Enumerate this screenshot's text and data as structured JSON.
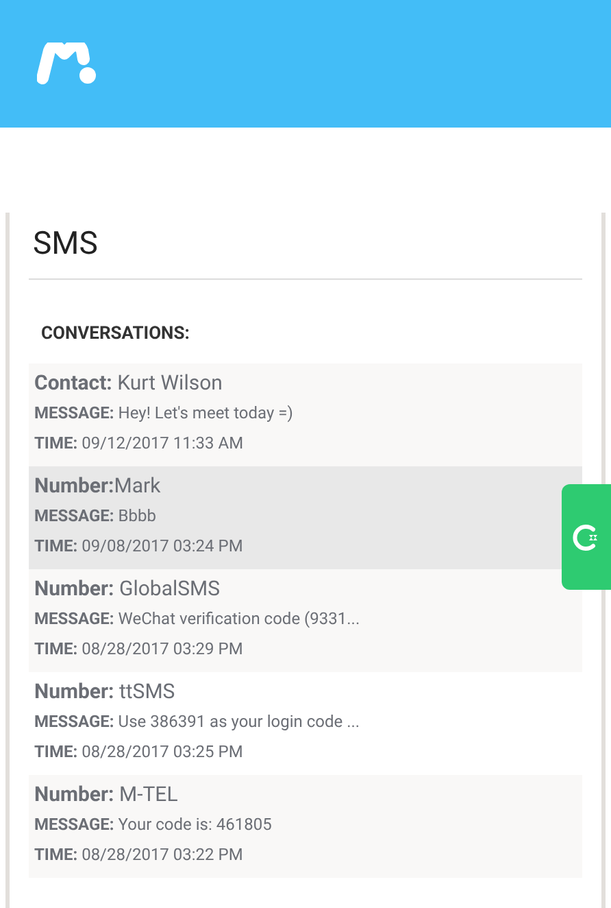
{
  "page": {
    "title": "SMS",
    "section": "CONVERSATIONS:"
  },
  "conversations": [
    {
      "name": "**Contact:** Kurt Wilson",
      "message": "**MESSAGE:** Hey! Let's meet today =)",
      "time": "**TIME:** 09/12/2017 11:33 AM",
      "selected": false
    },
    {
      "name": "**Number:**Mark",
      "message": "**MESSAGE:** Bbbb",
      "time": "**TIME:** 09/08/2017 03:24 PM",
      "selected": true
    },
    {
      "name": "**Number:** GlobalSMS",
      "message": "**MESSAGE:** WeChat verification code (9331...",
      "time": "**TIME:** 08/28/2017 03:29 PM",
      "selected": false
    },
    {
      "name": "**Number:** ttSMS",
      "message": "**MESSAGE:** Use 386391 as your login code ...",
      "time": "**TIME:** 08/28/2017 03:25 PM",
      "selected": false
    },
    {
      "name": "**Number:** M-TEL",
      "message": "**MESSAGE:** Your code is: 461805",
      "time": "**TIME:** 08/28/2017 03:22 PM",
      "selected": false
    }
  ]
}
